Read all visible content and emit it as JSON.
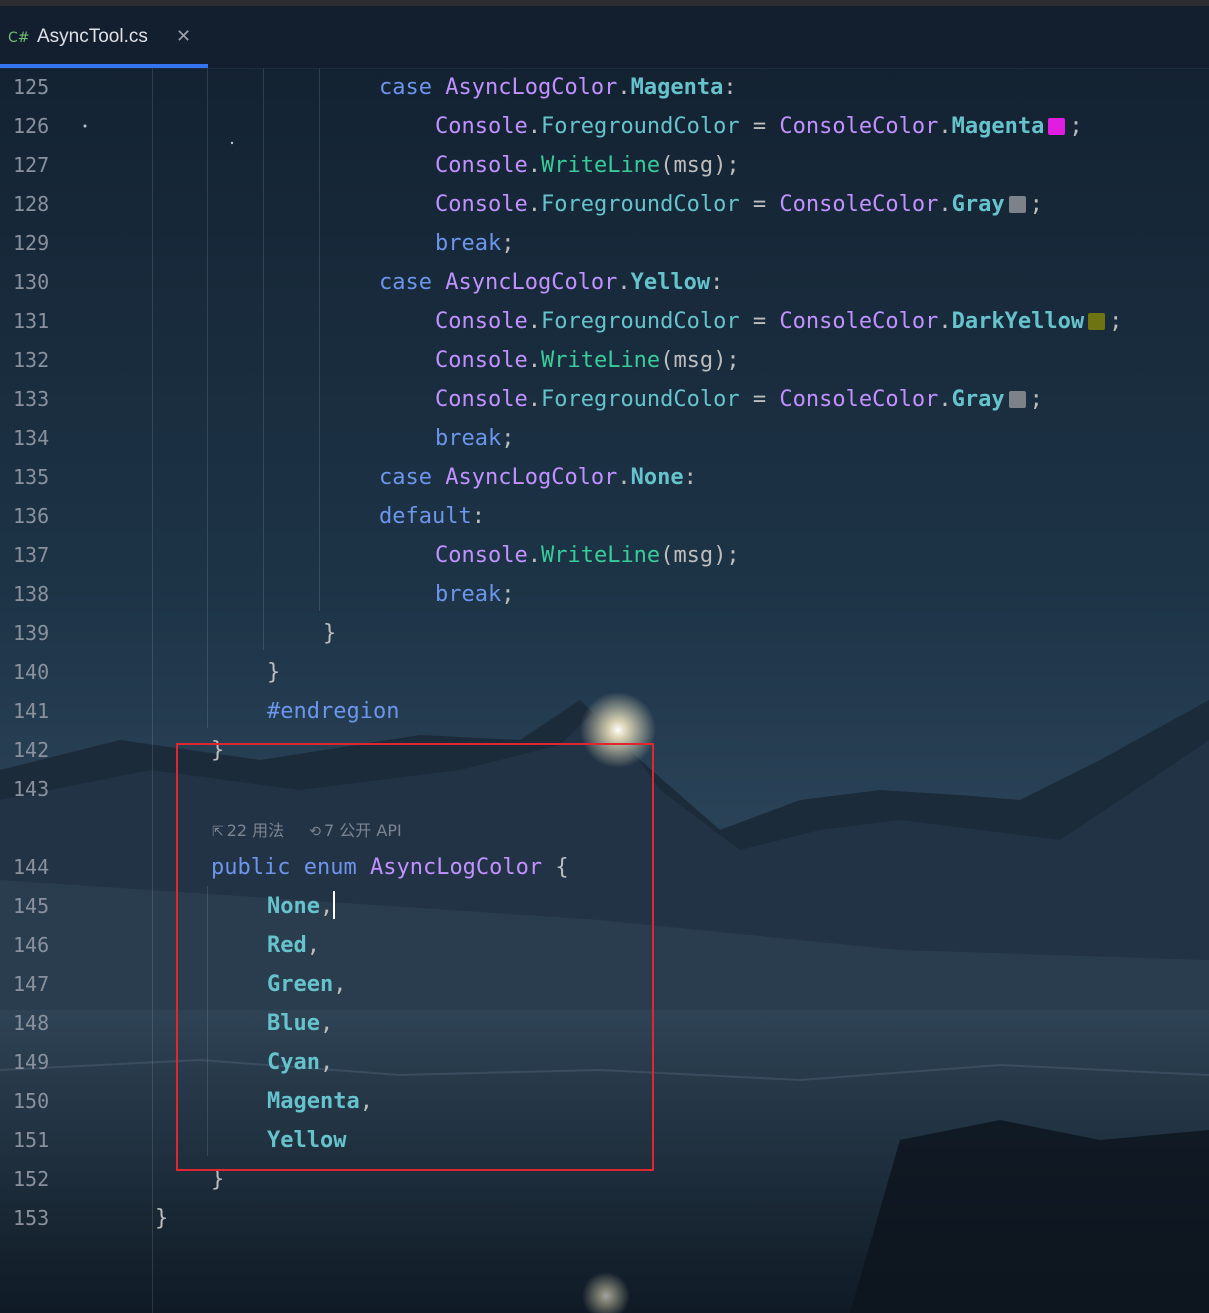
{
  "tab": {
    "icon_label": "C#",
    "title": "AsyncTool.cs",
    "close_glyph": "✕"
  },
  "colors": {
    "accent": "#3574f0",
    "highlight": "#e0262e",
    "magenta_swatch": "#e01de0",
    "gray_swatch": "#7d818a",
    "darkyellow_swatch": "#6f7412"
  },
  "code_lines": [
    {
      "n": "125",
      "indent": 5,
      "tokens": [
        [
          "kw",
          "case"
        ],
        [
          "pun",
          " "
        ],
        [
          "cls",
          "AsyncLogColor"
        ],
        [
          "pun",
          "."
        ],
        [
          "enm",
          "Magenta"
        ],
        [
          "pun",
          ":"
        ]
      ]
    },
    {
      "n": "126",
      "indent": 6,
      "tokens": [
        [
          "cls",
          "Console"
        ],
        [
          "pun",
          "."
        ],
        [
          "mem",
          "ForegroundColor"
        ],
        [
          "pun",
          " = "
        ],
        [
          "ty",
          "ConsoleColor"
        ],
        [
          "pun",
          "."
        ],
        [
          "enm",
          "Magenta"
        ],
        [
          "swatch",
          "#e01de0"
        ],
        [
          "pun",
          ";"
        ]
      ]
    },
    {
      "n": "127",
      "indent": 6,
      "tokens": [
        [
          "cls",
          "Console"
        ],
        [
          "pun",
          "."
        ],
        [
          "mth",
          "WriteLine"
        ],
        [
          "pun",
          "("
        ],
        [
          "var",
          "msg"
        ],
        [
          "pun",
          ");"
        ]
      ]
    },
    {
      "n": "128",
      "indent": 6,
      "tokens": [
        [
          "cls",
          "Console"
        ],
        [
          "pun",
          "."
        ],
        [
          "mem",
          "ForegroundColor"
        ],
        [
          "pun",
          " = "
        ],
        [
          "ty",
          "ConsoleColor"
        ],
        [
          "pun",
          "."
        ],
        [
          "enm",
          "Gray"
        ],
        [
          "swatch",
          "#7d818a"
        ],
        [
          "pun",
          ";"
        ]
      ]
    },
    {
      "n": "129",
      "indent": 6,
      "tokens": [
        [
          "kw",
          "break"
        ],
        [
          "pun",
          ";"
        ]
      ]
    },
    {
      "n": "130",
      "indent": 5,
      "tokens": [
        [
          "kw",
          "case"
        ],
        [
          "pun",
          " "
        ],
        [
          "cls",
          "AsyncLogColor"
        ],
        [
          "pun",
          "."
        ],
        [
          "enm",
          "Yellow"
        ],
        [
          "pun",
          ":"
        ]
      ]
    },
    {
      "n": "131",
      "indent": 6,
      "tokens": [
        [
          "cls",
          "Console"
        ],
        [
          "pun",
          "."
        ],
        [
          "mem",
          "ForegroundColor"
        ],
        [
          "pun",
          " = "
        ],
        [
          "ty",
          "ConsoleColor"
        ],
        [
          "pun",
          "."
        ],
        [
          "enm",
          "DarkYellow"
        ],
        [
          "swatch",
          "#6f7412"
        ],
        [
          "pun",
          ";"
        ]
      ]
    },
    {
      "n": "132",
      "indent": 6,
      "tokens": [
        [
          "cls",
          "Console"
        ],
        [
          "pun",
          "."
        ],
        [
          "mth",
          "WriteLine"
        ],
        [
          "pun",
          "("
        ],
        [
          "var",
          "msg"
        ],
        [
          "pun",
          ");"
        ]
      ]
    },
    {
      "n": "133",
      "indent": 6,
      "tokens": [
        [
          "cls",
          "Console"
        ],
        [
          "pun",
          "."
        ],
        [
          "mem",
          "ForegroundColor"
        ],
        [
          "pun",
          " = "
        ],
        [
          "ty",
          "ConsoleColor"
        ],
        [
          "pun",
          "."
        ],
        [
          "enm",
          "Gray"
        ],
        [
          "swatch",
          "#7d818a"
        ],
        [
          "pun",
          ";"
        ]
      ]
    },
    {
      "n": "134",
      "indent": 6,
      "tokens": [
        [
          "kw",
          "break"
        ],
        [
          "pun",
          ";"
        ]
      ]
    },
    {
      "n": "135",
      "indent": 5,
      "tokens": [
        [
          "kw",
          "case"
        ],
        [
          "pun",
          " "
        ],
        [
          "cls",
          "AsyncLogColor"
        ],
        [
          "pun",
          "."
        ],
        [
          "enm",
          "None"
        ],
        [
          "pun",
          ":"
        ]
      ]
    },
    {
      "n": "136",
      "indent": 5,
      "tokens": [
        [
          "kw",
          "default"
        ],
        [
          "pun",
          ":"
        ]
      ]
    },
    {
      "n": "137",
      "indent": 6,
      "tokens": [
        [
          "cls",
          "Console"
        ],
        [
          "pun",
          "."
        ],
        [
          "mth",
          "WriteLine"
        ],
        [
          "pun",
          "("
        ],
        [
          "var",
          "msg"
        ],
        [
          "pun",
          ");"
        ]
      ]
    },
    {
      "n": "138",
      "indent": 6,
      "tokens": [
        [
          "kw",
          "break"
        ],
        [
          "pun",
          ";"
        ]
      ]
    },
    {
      "n": "139",
      "indent": 4,
      "tokens": [
        [
          "pun",
          "}"
        ]
      ]
    },
    {
      "n": "140",
      "indent": 3,
      "tokens": [
        [
          "pun",
          "}"
        ]
      ]
    },
    {
      "n": "141",
      "indent": 3,
      "tokens": [
        [
          "pp",
          "#endregion"
        ]
      ]
    },
    {
      "n": "142",
      "indent": 2,
      "tokens": [
        [
          "pun",
          "}"
        ]
      ]
    },
    {
      "n": "143",
      "indent": 0,
      "tokens": []
    },
    {
      "n": "144",
      "indent": 2,
      "tokens": [
        [
          "kw",
          "public"
        ],
        [
          "pun",
          " "
        ],
        [
          "kw",
          "enum"
        ],
        [
          "pun",
          " "
        ],
        [
          "cls",
          "AsyncLogColor"
        ],
        [
          "pun",
          " {"
        ]
      ]
    },
    {
      "n": "145",
      "indent": 3,
      "tokens": [
        [
          "enm",
          "None"
        ],
        [
          "pun",
          ","
        ],
        [
          "caret",
          ""
        ]
      ]
    },
    {
      "n": "146",
      "indent": 3,
      "tokens": [
        [
          "enm",
          "Red"
        ],
        [
          "pun",
          ","
        ]
      ]
    },
    {
      "n": "147",
      "indent": 3,
      "tokens": [
        [
          "enm",
          "Green"
        ],
        [
          "pun",
          ","
        ]
      ]
    },
    {
      "n": "148",
      "indent": 3,
      "tokens": [
        [
          "enm",
          "Blue"
        ],
        [
          "pun",
          ","
        ]
      ]
    },
    {
      "n": "149",
      "indent": 3,
      "tokens": [
        [
          "enm",
          "Cyan"
        ],
        [
          "pun",
          ","
        ]
      ]
    },
    {
      "n": "150",
      "indent": 3,
      "tokens": [
        [
          "enm",
          "Magenta"
        ],
        [
          "pun",
          ","
        ]
      ]
    },
    {
      "n": "151",
      "indent": 3,
      "tokens": [
        [
          "enm",
          "Yellow"
        ]
      ]
    },
    {
      "n": "152",
      "indent": 2,
      "tokens": [
        [
          "pun",
          "}"
        ]
      ]
    },
    {
      "n": "153",
      "indent": 1,
      "tokens": [
        [
          "pun",
          "}"
        ]
      ]
    }
  ],
  "inlay_hints": [
    {
      "icon": "⇱",
      "label": "22 用法"
    },
    {
      "icon": "⟲",
      "label": "7 公开 API"
    }
  ]
}
